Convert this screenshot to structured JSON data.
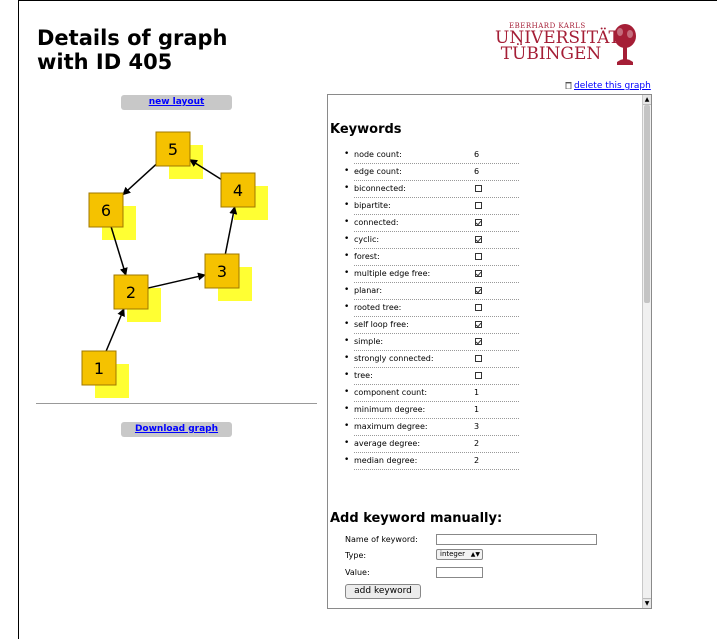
{
  "header": {
    "title_line1": "Details of graph",
    "title_line2": "with ID 405",
    "logo_small": "EBERHARD KARLS",
    "logo_line1": "UNIVERSITÄT",
    "logo_line2": "TÜBINGEN",
    "logo_color": "#a51e36",
    "delete_link": "delete this graph"
  },
  "left": {
    "new_layout": "new layout",
    "download": "Download graph",
    "button_bg": "#c8c8c8",
    "node_color": "#f5c200",
    "shadow_color": "#ffff33"
  },
  "graph": {
    "nodes": [
      {
        "label": "1"
      },
      {
        "label": "2"
      },
      {
        "label": "3"
      },
      {
        "label": "4"
      },
      {
        "label": "5"
      },
      {
        "label": "6"
      }
    ],
    "edges": [
      [
        "1",
        "2"
      ],
      [
        "2",
        "3"
      ],
      [
        "3",
        "4"
      ],
      [
        "4",
        "5"
      ],
      [
        "5",
        "6"
      ],
      [
        "6",
        "2"
      ]
    ]
  },
  "keywords": {
    "heading": "Keywords",
    "items": [
      {
        "label": "node count:",
        "value": "6"
      },
      {
        "label": "edge count:",
        "value": "6"
      },
      {
        "label": "biconnected:",
        "checked": false
      },
      {
        "label": "bipartite:",
        "checked": false
      },
      {
        "label": "connected:",
        "checked": true
      },
      {
        "label": "cyclic:",
        "checked": true
      },
      {
        "label": "forest:",
        "checked": false
      },
      {
        "label": "multiple edge free:",
        "checked": true
      },
      {
        "label": "planar:",
        "checked": true
      },
      {
        "label": "rooted tree:",
        "checked": false
      },
      {
        "label": "self loop free:",
        "checked": true
      },
      {
        "label": "simple:",
        "checked": true
      },
      {
        "label": "strongly connected:",
        "checked": false
      },
      {
        "label": "tree:",
        "checked": false
      },
      {
        "label": "component count:",
        "value": "1"
      },
      {
        "label": "minimum degree:",
        "value": "1"
      },
      {
        "label": "maximum degree:",
        "value": "3"
      },
      {
        "label": "average degree:",
        "value": "2"
      },
      {
        "label": "median degree:",
        "value": "2"
      }
    ]
  },
  "add_form": {
    "heading": "Add keyword manually:",
    "name_label": "Name of keyword:",
    "name_value": "",
    "type_label": "Type:",
    "type_selected": "integer",
    "value_label": "Value:",
    "value_value": "",
    "submit": "add keyword"
  }
}
